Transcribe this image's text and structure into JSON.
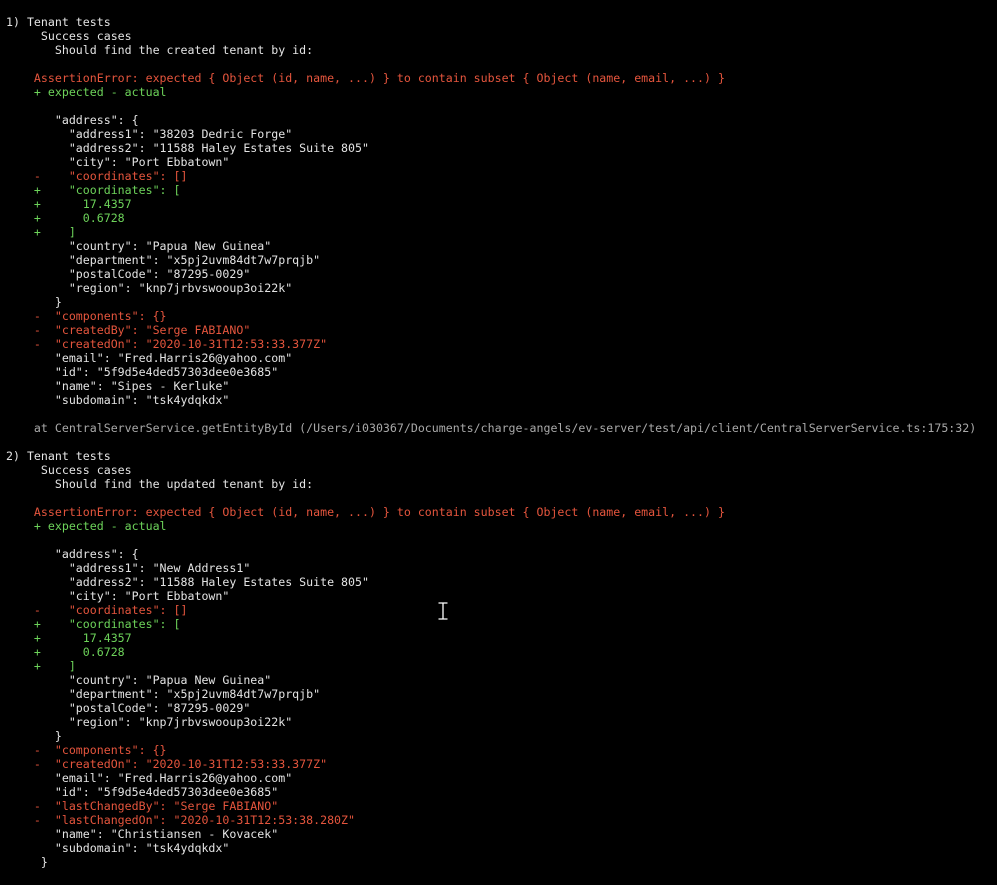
{
  "terminal": {
    "colors": {
      "background": "#000000",
      "normal": "#e4e4e4",
      "error": "#e5553d",
      "added": "#6dd35a",
      "stack": "#a9a9a9"
    },
    "cursor_icon": "text-cursor-icon",
    "lines": [
      {
        "text": "1) Tenant tests",
        "kind": "normal"
      },
      {
        "text": "     Success cases",
        "kind": "normal"
      },
      {
        "text": "       Should find the created tenant by id:",
        "kind": "normal"
      },
      {
        "text": "",
        "kind": "normal"
      },
      {
        "text": "    AssertionError: expected { Object (id, name, ...) } to contain subset { Object (name, email, ...) }",
        "kind": "red"
      },
      {
        "text": "    + expected - actual",
        "kind": "green"
      },
      {
        "text": "",
        "kind": "normal"
      },
      {
        "text": "       \"address\": {",
        "kind": "normal"
      },
      {
        "text": "         \"address1\": \"38203 Dedric Forge\"",
        "kind": "normal"
      },
      {
        "text": "         \"address2\": \"11588 Haley Estates Suite 805\"",
        "kind": "normal"
      },
      {
        "text": "         \"city\": \"Port Ebbatown\"",
        "kind": "normal"
      },
      {
        "text": "    -    \"coordinates\": []",
        "kind": "red"
      },
      {
        "text": "    +    \"coordinates\": [",
        "kind": "green"
      },
      {
        "text": "    +      17.4357",
        "kind": "green"
      },
      {
        "text": "    +      0.6728",
        "kind": "green"
      },
      {
        "text": "    +    ]",
        "kind": "green"
      },
      {
        "text": "         \"country\": \"Papua New Guinea\"",
        "kind": "normal"
      },
      {
        "text": "         \"department\": \"x5pj2uvm84dt7w7prqjb\"",
        "kind": "normal"
      },
      {
        "text": "         \"postalCode\": \"87295-0029\"",
        "kind": "normal"
      },
      {
        "text": "         \"region\": \"knp7jrbvswooup3oi22k\"",
        "kind": "normal"
      },
      {
        "text": "       }",
        "kind": "normal"
      },
      {
        "text": "    -  \"components\": {}",
        "kind": "red"
      },
      {
        "text": "    -  \"createdBy\": \"Serge FABIANO\"",
        "kind": "red"
      },
      {
        "text": "    -  \"createdOn\": \"2020-10-31T12:53:33.377Z\"",
        "kind": "red"
      },
      {
        "text": "       \"email\": \"Fred.Harris26@yahoo.com\"",
        "kind": "normal"
      },
      {
        "text": "       \"id\": \"5f9d5e4ded57303dee0e3685\"",
        "kind": "normal"
      },
      {
        "text": "       \"name\": \"Sipes - Kerluke\"",
        "kind": "normal"
      },
      {
        "text": "       \"subdomain\": \"tsk4ydqkdx\"",
        "kind": "normal"
      },
      {
        "text": "",
        "kind": "normal"
      },
      {
        "text": "    at CentralServerService.getEntityById (/Users/i030367/Documents/charge-angels/ev-server/test/api/client/CentralServerService.ts:175:32)",
        "kind": "gray"
      },
      {
        "text": "",
        "kind": "normal"
      },
      {
        "text": "2) Tenant tests",
        "kind": "normal"
      },
      {
        "text": "     Success cases",
        "kind": "normal"
      },
      {
        "text": "       Should find the updated tenant by id:",
        "kind": "normal"
      },
      {
        "text": "",
        "kind": "normal"
      },
      {
        "text": "    AssertionError: expected { Object (id, name, ...) } to contain subset { Object (name, email, ...) }",
        "kind": "red"
      },
      {
        "text": "    + expected - actual",
        "kind": "green"
      },
      {
        "text": "",
        "kind": "normal"
      },
      {
        "text": "       \"address\": {",
        "kind": "normal"
      },
      {
        "text": "         \"address1\": \"New Address1\"",
        "kind": "normal"
      },
      {
        "text": "         \"address2\": \"11588 Haley Estates Suite 805\"",
        "kind": "normal"
      },
      {
        "text": "         \"city\": \"Port Ebbatown\"",
        "kind": "normal"
      },
      {
        "text": "    -    \"coordinates\": []",
        "kind": "red"
      },
      {
        "text": "    +    \"coordinates\": [",
        "kind": "green"
      },
      {
        "text": "    +      17.4357",
        "kind": "green"
      },
      {
        "text": "    +      0.6728",
        "kind": "green"
      },
      {
        "text": "    +    ]",
        "kind": "green"
      },
      {
        "text": "         \"country\": \"Papua New Guinea\"",
        "kind": "normal"
      },
      {
        "text": "         \"department\": \"x5pj2uvm84dt7w7prqjb\"",
        "kind": "normal"
      },
      {
        "text": "         \"postalCode\": \"87295-0029\"",
        "kind": "normal"
      },
      {
        "text": "         \"region\": \"knp7jrbvswooup3oi22k\"",
        "kind": "normal"
      },
      {
        "text": "       }",
        "kind": "normal"
      },
      {
        "text": "    -  \"components\": {}",
        "kind": "red"
      },
      {
        "text": "    -  \"createdOn\": \"2020-10-31T12:53:33.377Z\"",
        "kind": "red"
      },
      {
        "text": "       \"email\": \"Fred.Harris26@yahoo.com\"",
        "kind": "normal"
      },
      {
        "text": "       \"id\": \"5f9d5e4ded57303dee0e3685\"",
        "kind": "normal"
      },
      {
        "text": "    -  \"lastChangedBy\": \"Serge FABIANO\"",
        "kind": "red"
      },
      {
        "text": "    -  \"lastChangedOn\": \"2020-10-31T12:53:38.280Z\"",
        "kind": "red"
      },
      {
        "text": "       \"name\": \"Christiansen - Kovacek\"",
        "kind": "normal"
      },
      {
        "text": "       \"subdomain\": \"tsk4ydqkdx\"",
        "kind": "normal"
      },
      {
        "text": "     }",
        "kind": "normal"
      }
    ]
  }
}
